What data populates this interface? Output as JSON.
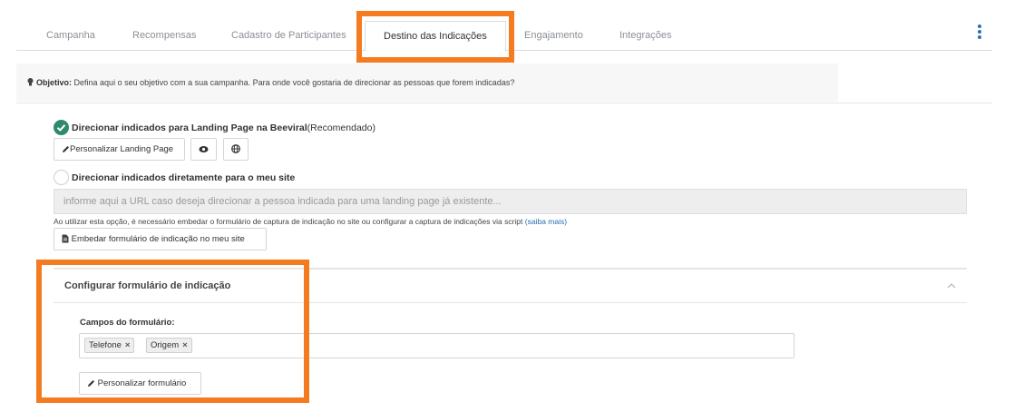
{
  "tabs": [
    {
      "label": "Campanha"
    },
    {
      "label": "Recompensas"
    },
    {
      "label": "Cadastro de Participantes"
    },
    {
      "label": "Destino das Indicações",
      "active": true
    },
    {
      "label": "Engajamento"
    },
    {
      "label": "Integrações"
    }
  ],
  "objective": {
    "prefix": "Objetivo:",
    "text": "Defina aqui o seu objetivo com a sua campanha. Para onde você gostaria de direcionar as pessoas que forem indicadas?"
  },
  "option_landing": {
    "label": "Direcionar indicados para Landing Page na Beeviral",
    "suffix": "(Recomendado)",
    "selected": true,
    "customize_button": "Personalizar Landing Page"
  },
  "option_site": {
    "label": "Direcionar indicados diretamente para o meu site",
    "selected": false,
    "url_placeholder": "informe aqui a URL caso deseja direcionar a pessoa indicada para uma landing page já existente...",
    "hint": "Ao utilizar esta opção, é necessário embedar o formulário de captura de indicação no site ou configurar a captura de indicações via script",
    "hint_link": "(saiba mais)",
    "embed_button": "Embedar formulário de indicação no meu site"
  },
  "form_panel": {
    "title": "Configurar formulário de indicação",
    "fields_label": "Campos do formulário:",
    "tags": [
      "Telefone",
      "Origem"
    ],
    "tag_remove": "×",
    "customize_button": "Personalizar formulário"
  },
  "colors": {
    "highlight": "#f47b20",
    "selected_radio": "#2e8a6e",
    "link": "#2a6fb0"
  },
  "icons": [
    "lightbulb-icon",
    "check-icon",
    "pencil-icon",
    "eye-icon",
    "globe-icon",
    "file-icon",
    "chevron-up-icon",
    "kebab-menu-icon"
  ]
}
